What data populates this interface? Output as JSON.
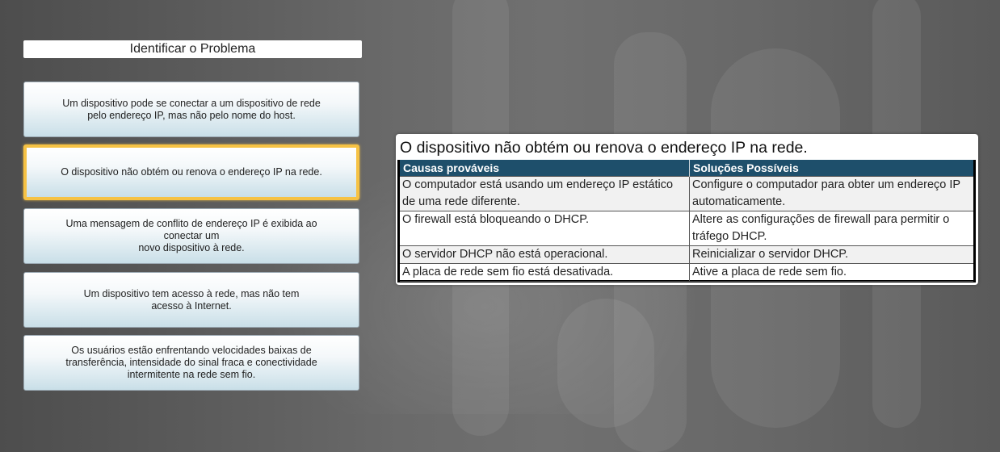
{
  "header": {
    "title": "Identificar o Problema"
  },
  "options": [
    "Um dispositivo pode se conectar a um dispositivo de rede\npelo endereço IP, mas não pelo nome do host.",
    "O dispositivo não obtém ou renova o endereço IP na rede.",
    "Uma mensagem de conflito de endereço IP é exibida ao\nconectar um\nnovo dispositivo à rede.",
    "Um dispositivo tem acesso à rede, mas não tem\nacesso à Internet.",
    "Os usuários estão enfrentando velocidades baixas de\ntransferência, intensidade do sinal fraca e conectividade\nintermitente na rede sem fio."
  ],
  "selected_option": 1,
  "panel": {
    "title": "O dispositivo não obtém ou renova o endereço IP na rede.",
    "headers": [
      "Causas prováveis",
      "Soluções Possíveis"
    ],
    "rows": [
      [
        "O computador está usando um endereço IP estático de uma rede diferente.",
        "Configure o computador para obter um endereço IP automaticamente."
      ],
      [
        "O firewall está bloqueando o DHCP.",
        "Altere as configurações de firewall para permitir o tráfego DHCP."
      ],
      [
        "O servidor DHCP não está operacional.",
        "Reinicializar o servidor DHCP."
      ],
      [
        "A placa de rede sem fio está desativada.",
        "Ative a placa de rede sem fio."
      ]
    ]
  },
  "colors": {
    "selected_border": "#f6c244",
    "table_header": "#1e4f6b"
  }
}
